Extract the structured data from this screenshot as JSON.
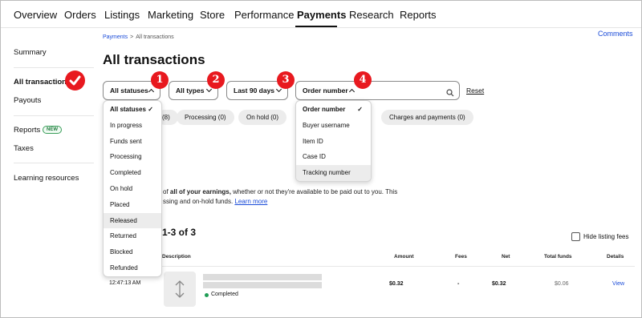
{
  "nav": {
    "items": [
      "Overview",
      "Orders",
      "Listings",
      "Marketing",
      "Store",
      "Performance",
      "Payments",
      "Research",
      "Reports"
    ],
    "active": "Payments"
  },
  "sidebar": {
    "summary": "Summary",
    "all_transactions": "All transactions",
    "payouts": "Payouts",
    "reports": "Reports",
    "new_badge": "NEW",
    "taxes": "Taxes",
    "learning": "Learning resources"
  },
  "breadcrumb": {
    "parent": "Payments",
    "separator": ">",
    "current": "All transactions"
  },
  "comments_link": "Comments",
  "page_title": "All transactions",
  "filters": {
    "status": "All statuses",
    "type": "All types",
    "period": "Last 90 days",
    "search_by": "Order number",
    "search_value": "",
    "reset": "Reset"
  },
  "markers": [
    "1",
    "2",
    "3",
    "4"
  ],
  "chips": [
    "(8)",
    "Processing (0)",
    "On hold (0)",
    "Charges and payments (0)"
  ],
  "status_menu": {
    "items": [
      "All statuses",
      "In progress",
      "Funds sent",
      "Processing",
      "Completed",
      "On hold",
      "Placed",
      "Released",
      "Returned",
      "Blocked",
      "Refunded"
    ],
    "selected": "All statuses",
    "highlighted": "Released",
    "check": "✓"
  },
  "search_menu": {
    "items": [
      "Order number",
      "Buyer username",
      "Item ID",
      "Case ID",
      "Tracking number"
    ],
    "selected": "Order number",
    "highlighted": "Tracking number",
    "check": "✓"
  },
  "info": {
    "prefix": "of ",
    "bold": "all of your earnings,",
    "rest": " whether or not they're available to be paid out to you. This",
    "line2": "ssing and on-hold funds. ",
    "link": "Learn more"
  },
  "results_count": "1-3 of 3",
  "hide_fees": "Hide listing fees",
  "table": {
    "headers": [
      "Description",
      "Amount",
      "Fees",
      "Net",
      "Total funds",
      "Details"
    ],
    "rows": [
      {
        "time": "12:47:13 AM",
        "status": "Completed",
        "amount": "$0.32",
        "fees": "-",
        "net": "$0.32",
        "total_funds": "$0.06",
        "details": "View"
      }
    ]
  },
  "colors": {
    "accent_red": "#e8191f",
    "link_blue": "#1a4bd8",
    "success_green": "#1f9d55"
  }
}
